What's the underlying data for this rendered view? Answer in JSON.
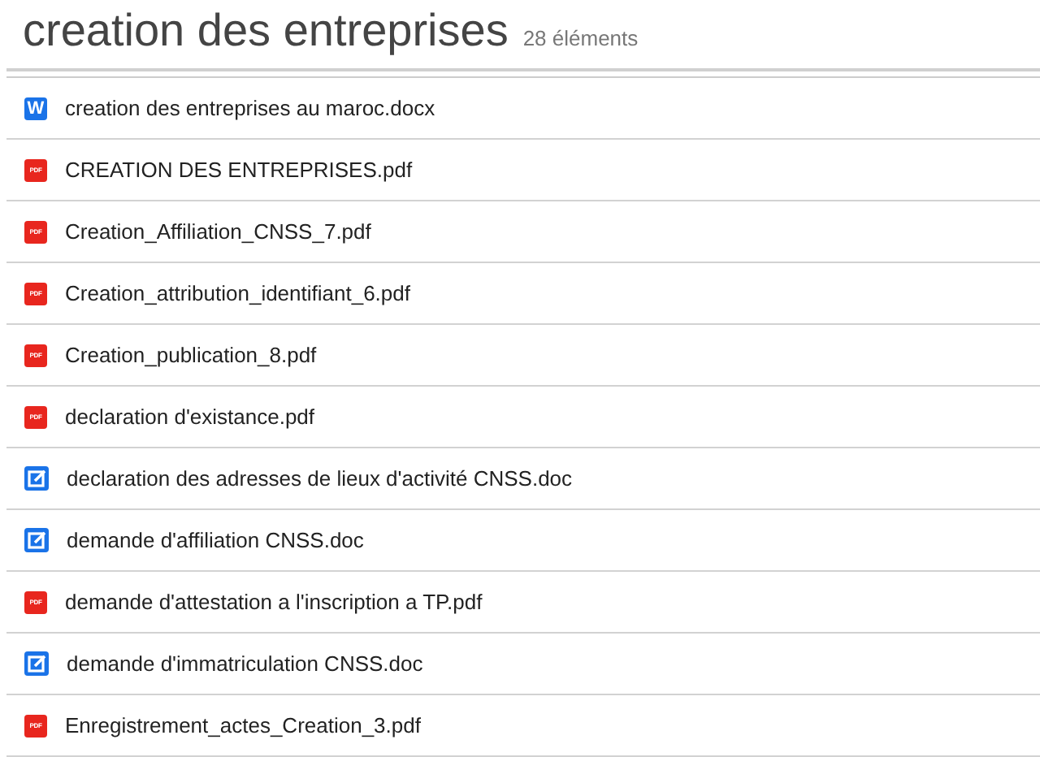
{
  "folder": {
    "title": "creation des entreprises",
    "count": "28 éléments"
  },
  "files": [
    {
      "kind": "word",
      "icon_label": "W",
      "name": "creation des entreprises au maroc.docx"
    },
    {
      "kind": "pdf",
      "icon_label": "PDF",
      "name": "CREATION DES ENTREPRISES.pdf"
    },
    {
      "kind": "pdf",
      "icon_label": "PDF",
      "name": "Creation_Affiliation_CNSS_7.pdf"
    },
    {
      "kind": "pdf",
      "icon_label": "PDF",
      "name": "Creation_attribution_identifiant_6.pdf"
    },
    {
      "kind": "pdf",
      "icon_label": "PDF",
      "name": "Creation_publication_8.pdf"
    },
    {
      "kind": "pdf",
      "icon_label": "PDF",
      "name": "declaration d'existance.pdf"
    },
    {
      "kind": "form",
      "name": "declaration des adresses de lieux d'activité CNSS.doc"
    },
    {
      "kind": "form",
      "name": "demande d'affiliation CNSS.doc"
    },
    {
      "kind": "pdf",
      "icon_label": "PDF",
      "name": "demande d'attestation a l'inscription a TP.pdf"
    },
    {
      "kind": "form",
      "name": "demande d'immatriculation CNSS.doc"
    },
    {
      "kind": "pdf",
      "icon_label": "PDF",
      "name": "Enregistrement_actes_Creation_3.pdf"
    }
  ]
}
